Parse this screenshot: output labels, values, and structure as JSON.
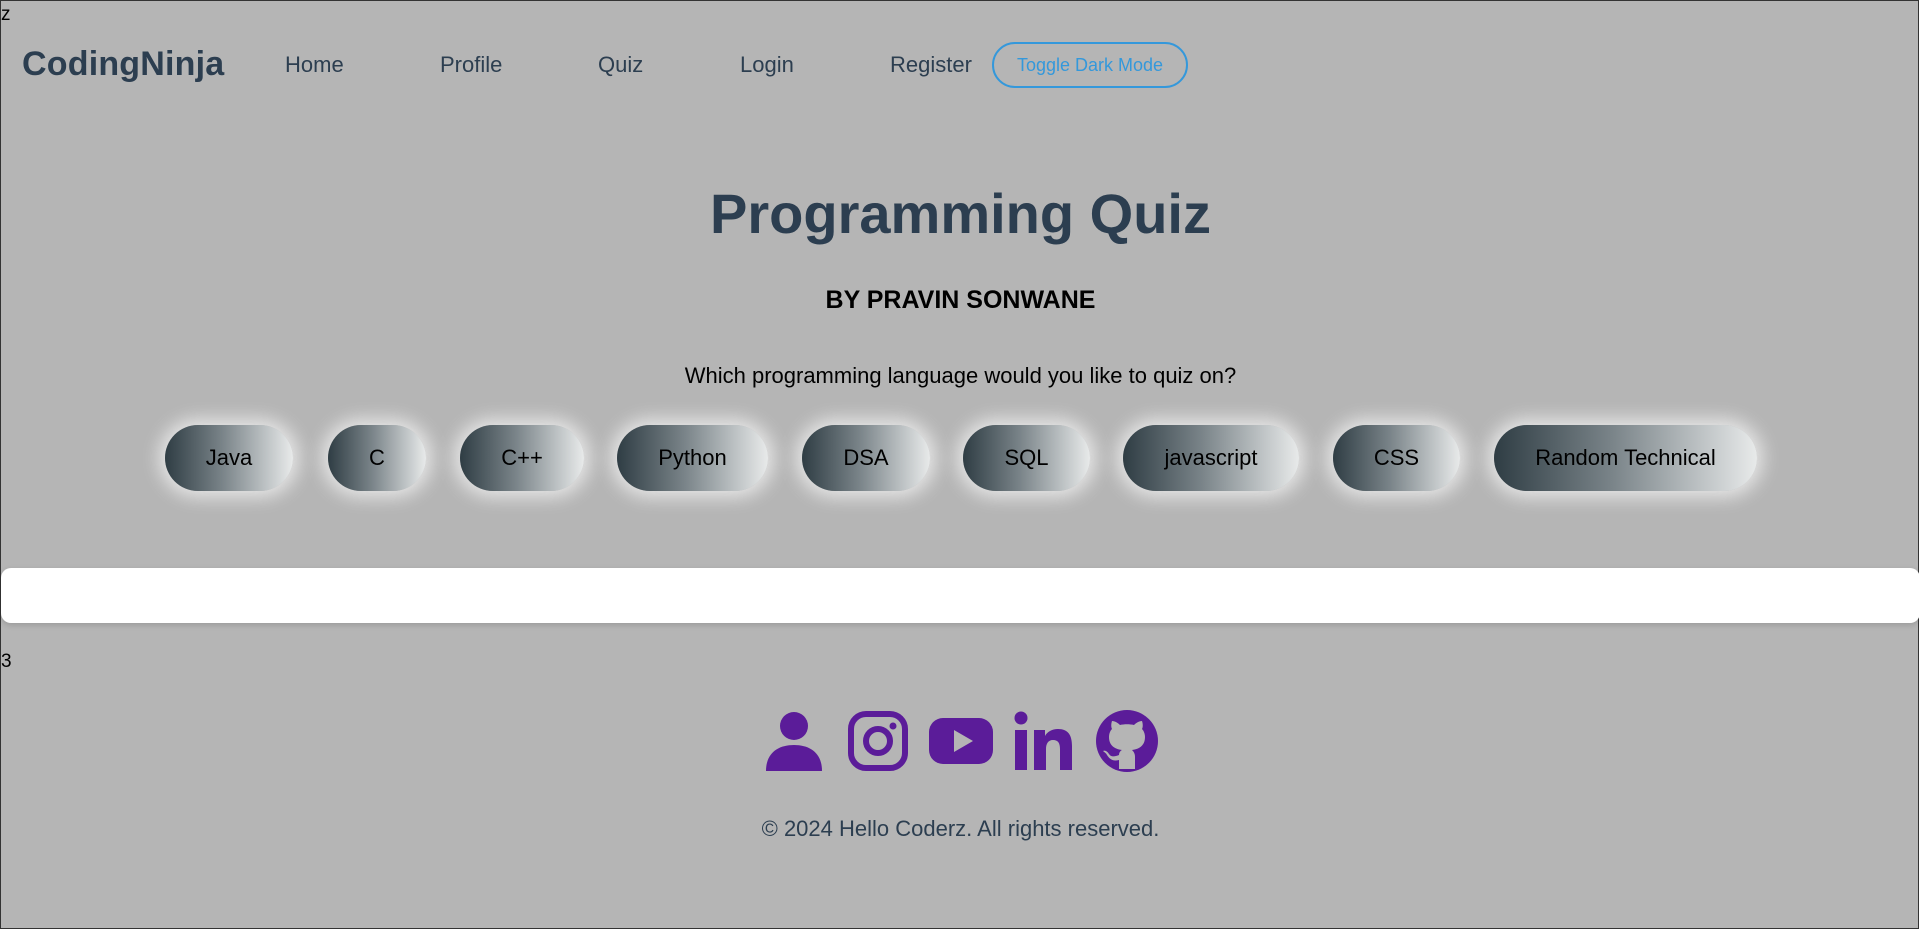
{
  "stray": {
    "top": "z",
    "middle": "3"
  },
  "nav": {
    "brand": "CodingNinja",
    "links": [
      "Home",
      "Profile",
      "Quiz",
      "Login",
      "Register"
    ],
    "toggle_label": "Toggle Dark Mode"
  },
  "main": {
    "title": "Programming Quiz",
    "subtitle": "BY PRAVIN SONWANE",
    "prompt": "Which programming language would you like to quiz on?",
    "languages": [
      "Java",
      "C",
      "C++",
      "Python",
      "DSA",
      "SQL",
      "javascript",
      "CSS",
      "Random Technical"
    ]
  },
  "footer": {
    "social_icons": [
      "user-icon",
      "instagram-icon",
      "youtube-icon",
      "linkedin-icon",
      "github-icon"
    ],
    "copyright": "© 2024 Hello Coderz. All rights reserved."
  },
  "colors": {
    "background": "#b5b5b5",
    "brand": "#2c3e50",
    "accent_blue": "#3498db",
    "icon_purple": "#5b1c99"
  }
}
